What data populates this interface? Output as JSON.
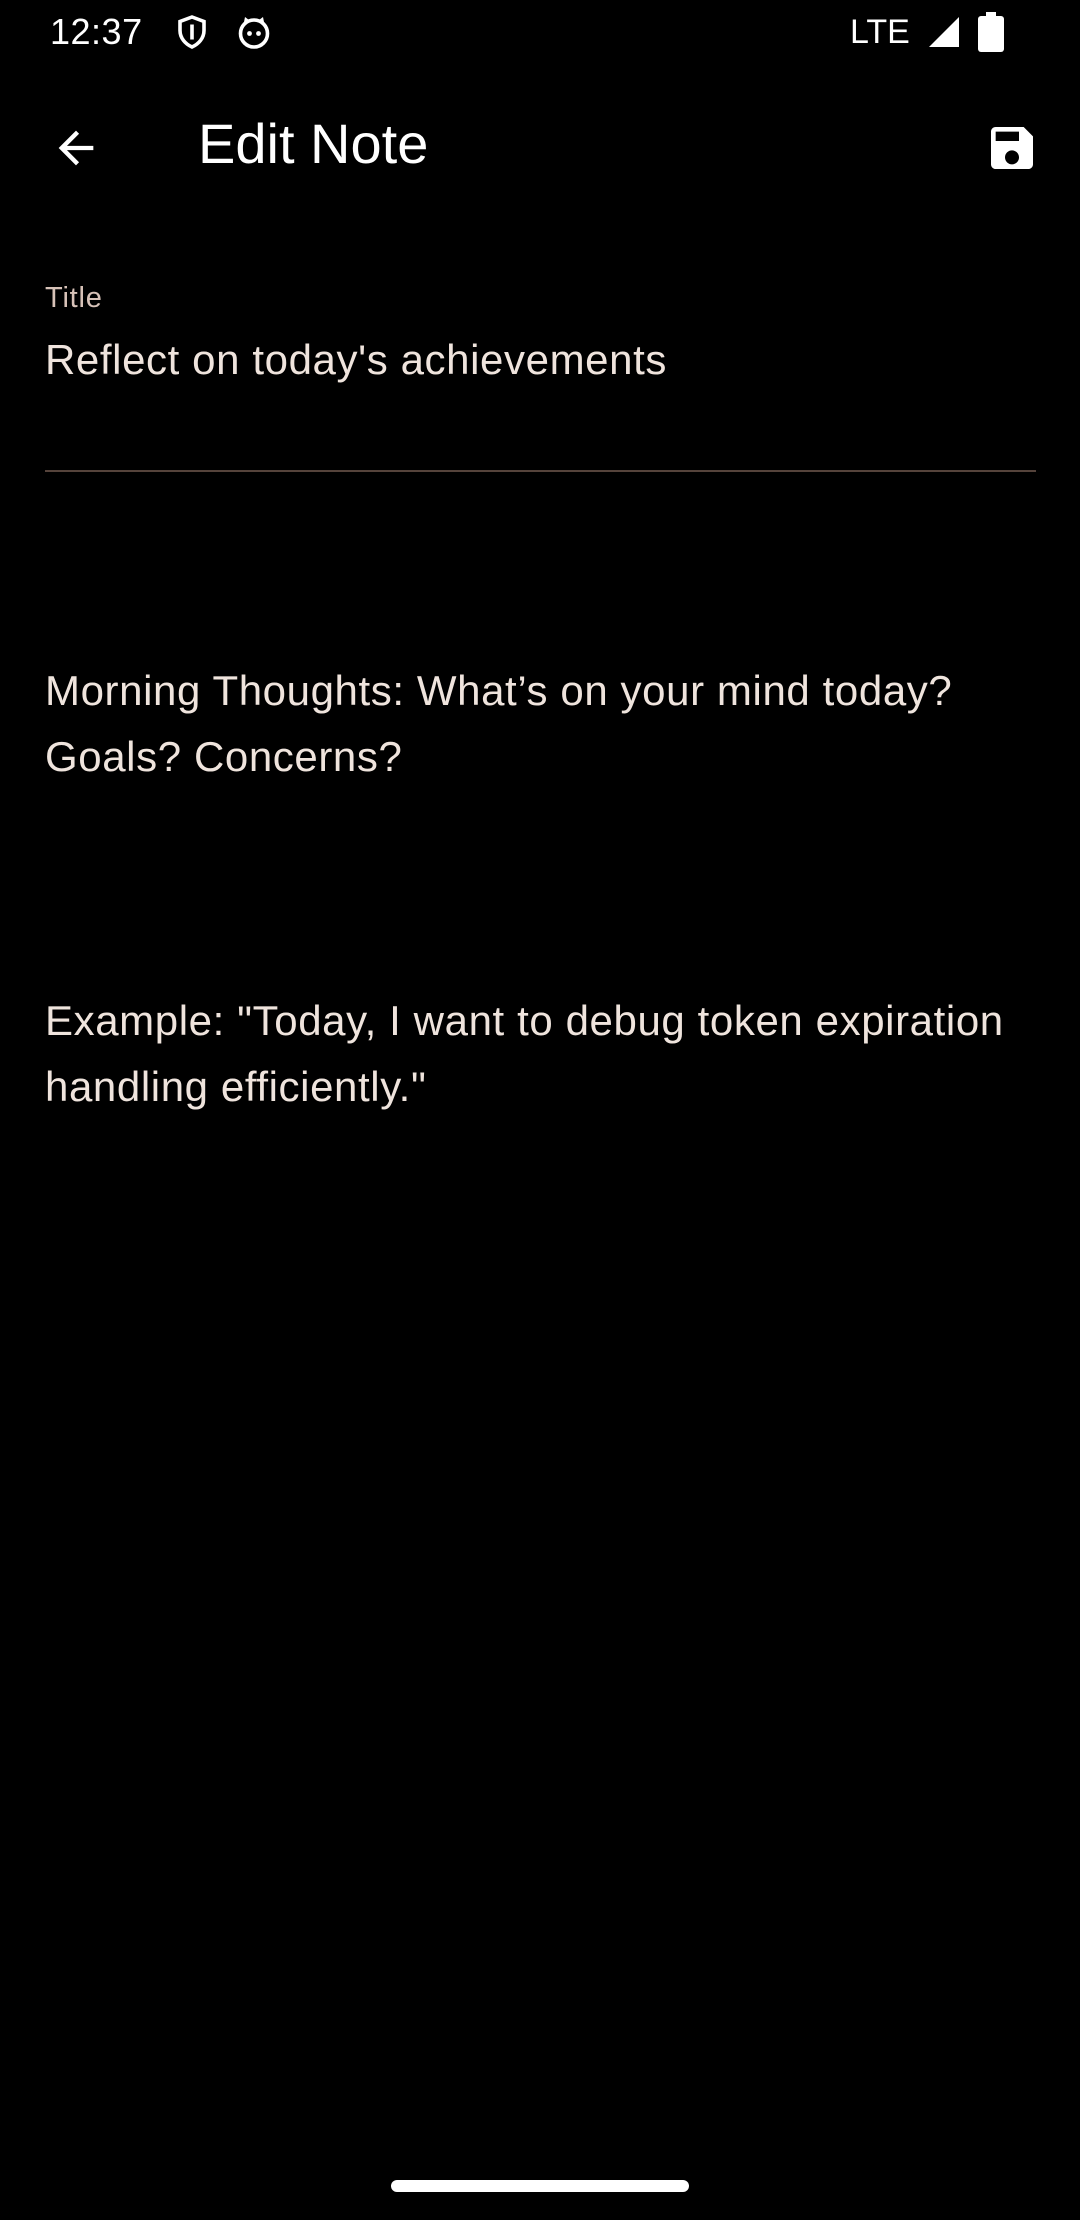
{
  "status_bar": {
    "time": "12:37",
    "network": "LTE",
    "icons": [
      "shield-icon",
      "cat-face-icon",
      "signal-icon",
      "battery-icon"
    ]
  },
  "app_bar": {
    "title": "Edit Note",
    "back_icon": "arrow-back-icon",
    "save_icon": "save-icon"
  },
  "note": {
    "title_label": "Title",
    "title_value": "Reflect on today's achievements",
    "body_paragraphs": [
      "Morning Thoughts: What’s on your mind today? Goals? Concerns?",
      "Example: \"Today, I want to debug token expiration handling efficiently.\""
    ]
  },
  "colors": {
    "background": "#000000",
    "text": "#efe4dd",
    "label": "#d7c2b8",
    "divider": "#55433b"
  }
}
